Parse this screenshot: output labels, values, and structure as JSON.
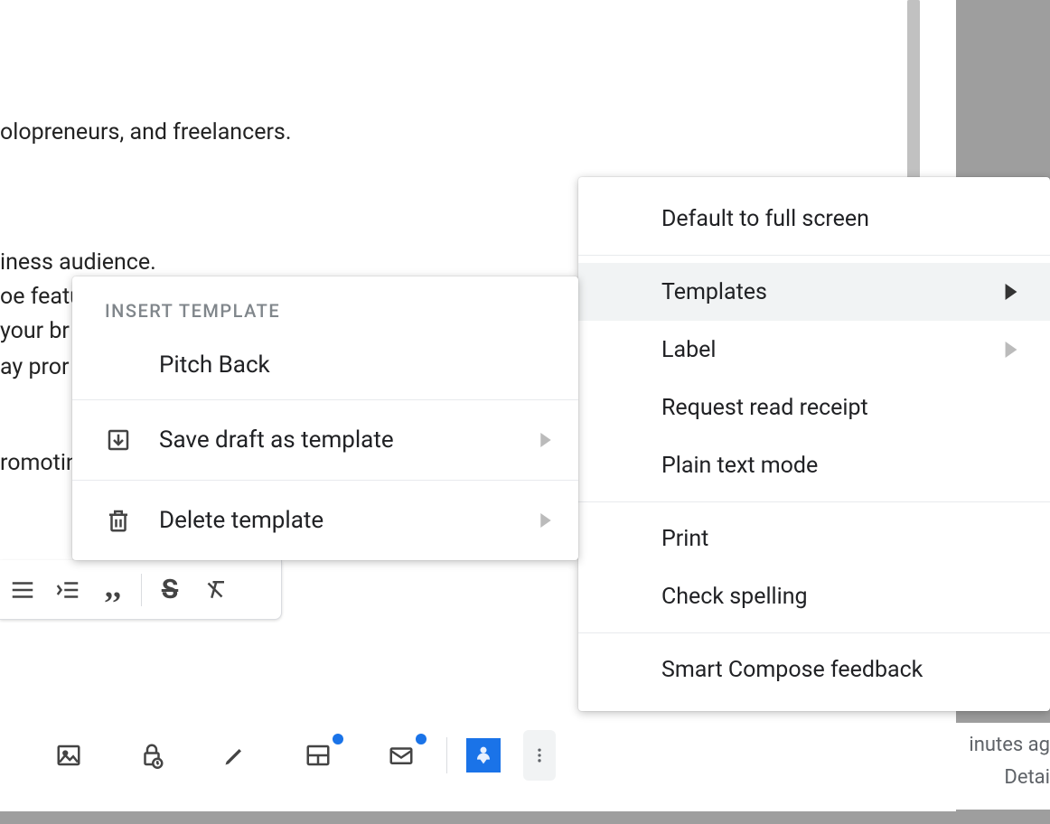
{
  "compose_body": {
    "line1": "olopreneurs, and freelancers.",
    "line2": "iness audience.",
    "line3": "oe featu",
    "line4": " your br",
    "line5": "ay pror",
    "line6": "romotin"
  },
  "main_menu": {
    "default_full_screen": "Default to full screen",
    "templates": "Templates",
    "label": "Label",
    "request_read_receipt": "Request read receipt",
    "plain_text_mode": "Plain text mode",
    "print": "Print",
    "check_spelling": "Check spelling",
    "smart_compose_feedback": "Smart Compose feedback"
  },
  "sub_menu": {
    "header": "INSERT TEMPLATE",
    "template_name": "Pitch Back",
    "save_draft": "Save draft as template",
    "delete_template": "Delete template"
  },
  "footer": {
    "minutes_ago": "inutes ag",
    "details": "Detai"
  }
}
